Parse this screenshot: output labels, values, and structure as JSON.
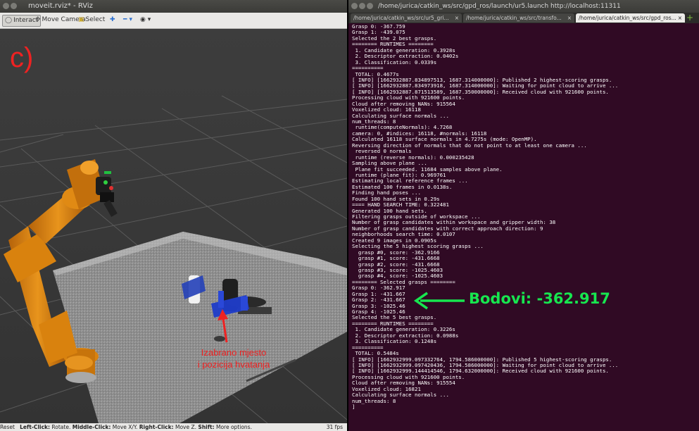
{
  "rviz": {
    "title": "moveit.rviz* - RViz",
    "toolbar": {
      "interact": "Interact",
      "move_camera": "Move Camera",
      "select": "Select"
    },
    "status_bar": {
      "reset": "Reset",
      "left_click_key": "Left-Click:",
      "left_click_action": "Rotate.",
      "middle_click_key": "Middle-Click:",
      "middle_click_action": "Move X/Y.",
      "right_click_key": "Right-Click:",
      "right_click_action": "Move Z.",
      "shift_key": "Shift:",
      "shift_action": "More options.",
      "fps": "31 fps"
    }
  },
  "terminal": {
    "title": "/home/jurica/catkin_ws/src/gpd_ros/launch/ur5.launch http://localhost:11311",
    "tabs": [
      {
        "label": "/home/jurica/catkin_ws/src/ur5_gri...",
        "active": false
      },
      {
        "label": "/home/jurica/catkin_ws/src/transfo...",
        "active": false
      },
      {
        "label": "/home/jurica/catkin_ws/src/gpd_ros...",
        "active": true
      }
    ],
    "add_tab": "+",
    "lines": [
      "Grasp 0: -367.759",
      "Grasp 1: -439.075",
      "Selected the 2 best grasps.",
      "======== RUNTIMES ========",
      " 1. Candidate generation: 0.3928s",
      " 2. Descriptor extraction: 0.0402s",
      " 3. Classification: 0.0339s",
      "==========",
      " TOTAL: 0.4677s",
      "[ INFO] [1662932887.834897513, 1687.314000000]: Published 2 highest-scoring grasps.",
      "[ INFO] [1662932887.834973918, 1687.314000000]: Waiting for point cloud to arrive ...",
      "[ INFO] [1662932887.871513589, 1687.350000000]: Received cloud with 921600 points.",
      "Processing cloud with 921600 points.",
      "Cloud after removing NANs: 915564",
      "Voxelized cloud: 16118",
      "Calculating surface normals ...",
      "num_threads: 8",
      " runtime(computeNormals): 4.7268",
      "camera: 0, #indices: 16118, #normals: 16118",
      "Calculated 16118 surface normals in 4.7275s (mode: OpenMP).",
      "Reversing direction of normals that do not point to at least one camera ...",
      " reversed 0 normals",
      " runtime (reverse normals): 0.000235428",
      "Sampling above plane ...",
      " Plane fit succeeded. 11684 samples above plane.",
      " runtime (plane fit): 0.969761",
      "Estimating local reference frames ...",
      "Estimated 100 frames in 0.0138s.",
      "Finding hand poses ...",
      "Found 100 hand sets in 0.29s",
      "==== HAND SEARCH TIME: 0.322481",
      "Generated 100 hand sets.",
      "Filtering grasps outside of workspace ...",
      "Number of grasp candidates within workspace and gripper width: 38",
      "Number of grasp candidates with correct approach direction: 9",
      "neighborhoods search time: 0.0107",
      "Created 9 images in 0.0905s",
      "Selecting the 5 highest scoring grasps ...",
      "  grasp #0, score: -362.9166",
      "  grasp #1, score: -431.6668",
      "  grasp #2, score: -431.6668",
      "  grasp #3, score: -1025.4603",
      "  grasp #4, score: -1025.4603",
      "======== Selected grasps ========",
      "Grasp 0: -362.917",
      "Grasp 1: -431.667",
      "Grasp 2: -431.667",
      "Grasp 3: -1025.46",
      "Grasp 4: -1025.46",
      "Selected the 5 best grasps.",
      "======== RUNTIMES ========",
      " 1. Candidate generation: 0.3226s",
      " 2. Descriptor extraction: 0.0988s",
      " 3. Classification: 0.1248s",
      "==========",
      " TOTAL: 0.5484s",
      "[ INFO] [1662932999.097332764, 1794.586000000]: Published 5 highest-scoring grasps.",
      "[ INFO] [1662932999.097420436, 1794.586000000]: Waiting for point cloud to arrive ...",
      "[ INFO] [1662932999.144414546, 1794.632000000]: Received cloud with 921600 points.",
      "Processing cloud with 921600 points.",
      "Cloud after removing NANs: 915554",
      "Voxelized cloud: 16821",
      "Calculating surface normals ...",
      "num_threads: 8",
      "]"
    ]
  },
  "annotations": {
    "figure_label": "c)",
    "score_label": "Bodovi: -362.917",
    "selection_line1": "Izabrano mjesto",
    "selection_line2": "i pozicija hvatanja"
  },
  "colors": {
    "annotation_red": "#ee2222",
    "annotation_green": "#17e64f",
    "robot_orange": "#d9820e",
    "terminal_bg": "#300a24",
    "viewport_bg": "#3b3b3b"
  },
  "icons": [
    "interact-icon",
    "move-camera-icon",
    "select-icon",
    "plus-icon",
    "minus-icon",
    "eye-icon",
    "close-icon",
    "new-tab-icon"
  ]
}
